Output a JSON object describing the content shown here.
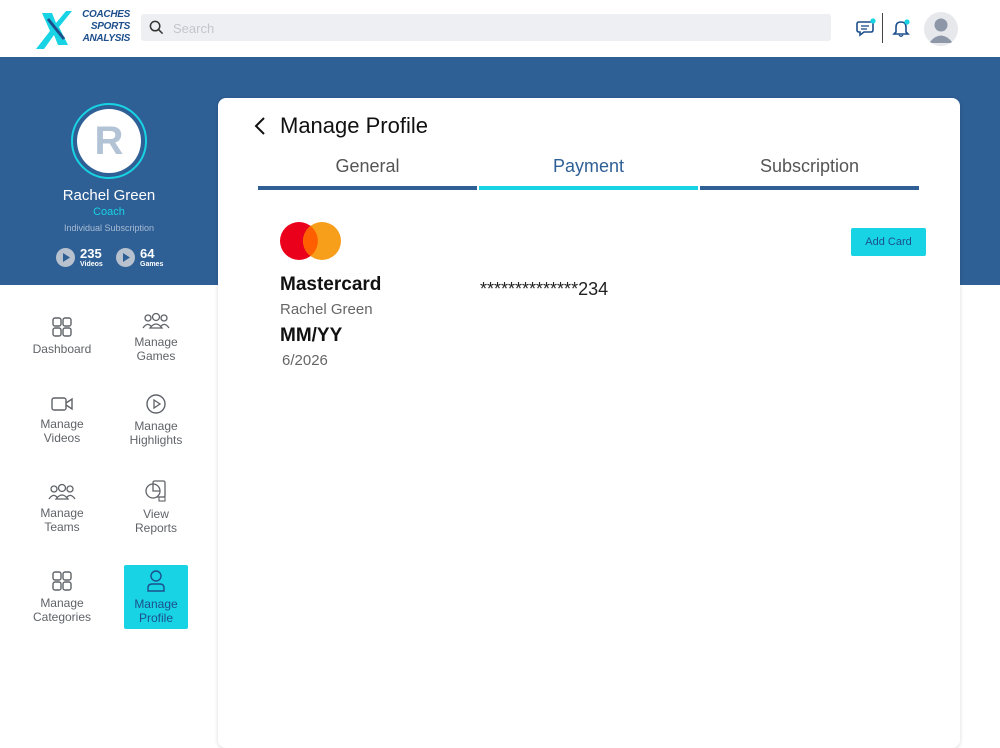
{
  "brand": {
    "logo_lines": [
      "COACHES",
      "SPORTS",
      "ANALYSIS"
    ],
    "accent": "#17d3e4",
    "primary": "#2e5f95"
  },
  "search": {
    "placeholder": "Search",
    "value": ""
  },
  "profile": {
    "initial": "R",
    "name": "Rachel Green",
    "role": "Coach",
    "plan": "Individual Subscription",
    "stats": [
      {
        "value": "235",
        "label": "Videos"
      },
      {
        "value": "64",
        "label": "Games"
      }
    ]
  },
  "nav": [
    {
      "label": "Dashboard",
      "icon": "grid-icon"
    },
    {
      "label": "Manage\nGames",
      "icon": "group-icon"
    },
    {
      "label": "Manage\nVideos",
      "icon": "video-icon"
    },
    {
      "label": "Manage\nHighlights",
      "icon": "play-circle-icon"
    },
    {
      "label": "Manage\nTeams",
      "icon": "group-icon"
    },
    {
      "label": "View\nReports",
      "icon": "report-icon"
    },
    {
      "label": "Manage\nCategories",
      "icon": "grid-icon"
    },
    {
      "label": "Manage\nProfile",
      "icon": "user-icon",
      "active": true
    }
  ],
  "page": {
    "title": "Manage Profile",
    "tabs": [
      "General",
      "Payment",
      "Subscription"
    ],
    "active_tab": "Payment"
  },
  "card_info": {
    "brand": "Mastercard",
    "holder": "Rachel Green",
    "expiry_label": "MM/YY",
    "expiry": "6/2026",
    "number_masked": "**************234",
    "add_button": "Add Card"
  }
}
